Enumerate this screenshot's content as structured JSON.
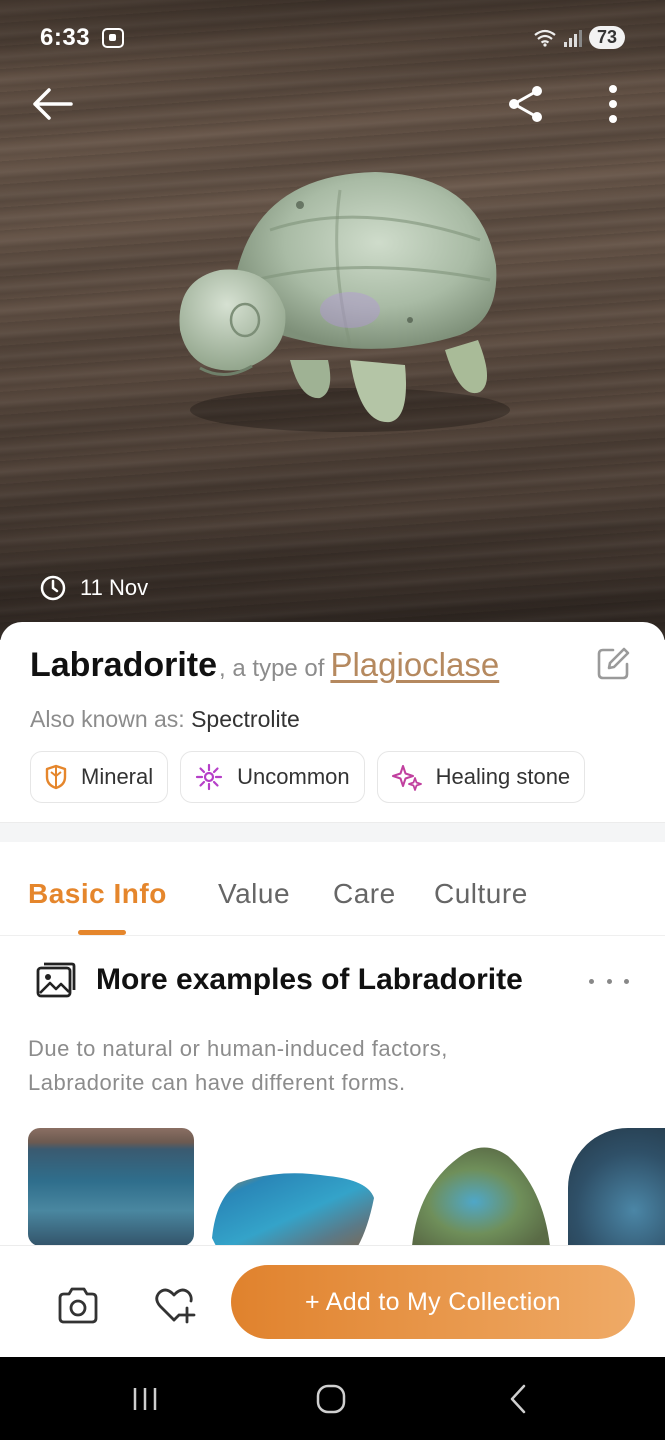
{
  "status_bar": {
    "time": "6:33",
    "battery": "73"
  },
  "hero": {
    "photo_subject": "carved labradorite turtle on wooden surface",
    "date": "11 Nov"
  },
  "icons": {
    "back": "arrow-left-icon",
    "share": "share-icon",
    "more": "more-vertical-icon",
    "clock": "clock-icon",
    "edit": "edit-icon",
    "gallery": "image-gallery-icon",
    "camera": "camera-icon",
    "wishlist": "heart-plus-icon"
  },
  "stone": {
    "name": "Labradorite",
    "type_prefix": ", a type of ",
    "type_link": "Plagioclase",
    "aka_label": "Also known as: ",
    "aka_value": "Spectrolite",
    "tags": [
      {
        "label": "Mineral",
        "icon": "shield-icon",
        "color": "#e5862c"
      },
      {
        "label": "Uncommon",
        "icon": "sparkle-icon",
        "color": "#b63fc8"
      },
      {
        "label": "Healing stone",
        "icon": "stars-icon",
        "color": "#c1409f"
      }
    ]
  },
  "tabs": [
    {
      "label": "Basic Info",
      "active": true
    },
    {
      "label": "Value",
      "active": false
    },
    {
      "label": "Care",
      "active": false
    },
    {
      "label": "Culture",
      "active": false
    }
  ],
  "examples": {
    "title": "More examples of Labradorite",
    "description": "Due to natural or human-induced factors, Labradorite can have different forms."
  },
  "actions": {
    "add_collection": "+ Add to My Collection"
  },
  "colors": {
    "accent": "#e5862c",
    "link": "#b5895f"
  }
}
